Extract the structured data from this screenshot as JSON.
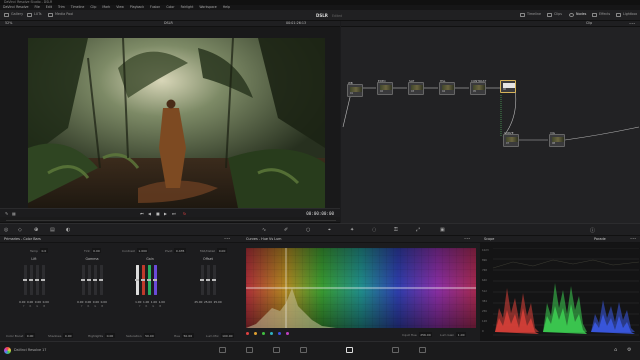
{
  "app": {
    "title": "DaVinci Resolve Studio - DSLR",
    "menu": [
      "DaVinci Resolve",
      "File",
      "Edit",
      "Trim",
      "Timeline",
      "Clip",
      "Mark",
      "View",
      "Playback",
      "Fusion",
      "Color",
      "Fairlight",
      "Workspace",
      "Help"
    ]
  },
  "toolbar": {
    "left": [
      "Gallery",
      "LUTs",
      "Media Pool"
    ],
    "project_title": "DSLR",
    "project_status": "Edited",
    "right": [
      "Timeline",
      "Clips",
      "Nodes",
      "Effects",
      "Lightbox"
    ]
  },
  "viewer": {
    "fit_label": "52%",
    "clip_name": "DSLR",
    "source_timecode": "00:01:26:13",
    "timecode": "00:00:00:00"
  },
  "nodegraph": {
    "mode": "Clip",
    "nodes": [
      {
        "label": "WB",
        "num": "01"
      },
      {
        "label": "EXPO",
        "num": "02"
      },
      {
        "label": "SAT",
        "num": "03"
      },
      {
        "label": "HSL",
        "num": "04"
      },
      {
        "label": "CONTRAST",
        "num": "05"
      },
      {
        "label": "",
        "num": "06"
      },
      {
        "label": "CURVE",
        "num": "07"
      },
      {
        "label": "VIG",
        "num": "08"
      }
    ]
  },
  "primaries": {
    "title": "Primaries - Color Bars",
    "params_top": [
      {
        "label": "Temp",
        "value": "0.0"
      },
      {
        "label": "Tint",
        "value": "0.00"
      },
      {
        "label": "Contrast",
        "value": "1.000"
      },
      {
        "label": "Pivot",
        "value": "0.435"
      },
      {
        "label": "Mid/Detail",
        "value": "0.00"
      }
    ],
    "wheels": [
      {
        "name": "Lift",
        "values": [
          "0.00",
          "0.00",
          "0.00",
          "0.00"
        ]
      },
      {
        "name": "Gamma",
        "values": [
          "0.00",
          "0.00",
          "0.00",
          "0.00"
        ]
      },
      {
        "name": "Gain",
        "values": [
          "1.00",
          "1.00",
          "1.00",
          "1.00"
        ]
      },
      {
        "name": "Offset",
        "values": [
          "25.00",
          "25.00",
          "25.00"
        ]
      }
    ],
    "channel_caps": [
      "Y",
      "R",
      "G",
      "B"
    ],
    "params_bottom": [
      {
        "label": "Color Boost",
        "value": "0.00"
      },
      {
        "label": "Shadows",
        "value": "0.00"
      },
      {
        "label": "Highlights",
        "value": "0.00"
      },
      {
        "label": "Saturation",
        "value": "50.00"
      },
      {
        "label": "Hue",
        "value": "50.00"
      },
      {
        "label": "Lum Mix",
        "value": "100.00"
      }
    ]
  },
  "curves": {
    "title": "Curves - Hue Vs Lum",
    "input_hue_label": "Input Hue",
    "input_hue_value": "256.00",
    "lum_gain_label": "Lum Gain",
    "lum_gain_value": "1.00"
  },
  "scope": {
    "title": "Scope",
    "mode": "Parade",
    "ticks": [
      "1023",
      "896",
      "768",
      "640",
      "512",
      "384",
      "256",
      "128",
      "0"
    ],
    "colors": {
      "red": "#e0413a",
      "green": "#3dd152",
      "blue": "#3b5ae8"
    }
  },
  "bottombar": {
    "app_name": "DaVinci Resolve 17"
  }
}
